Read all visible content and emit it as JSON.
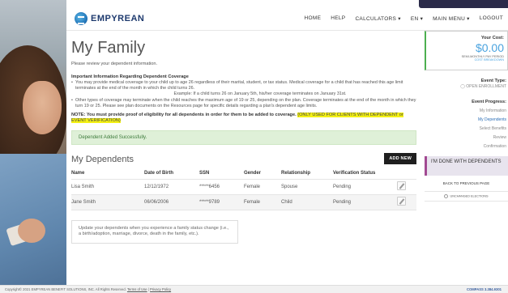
{
  "app": {
    "logo_text": "EMPYREAN"
  },
  "nav": {
    "home": "HOME",
    "help": "HELP",
    "calculators": "CALCULATORS ▾",
    "language": "EN ▾",
    "main_menu": "MAIN MENU ▾",
    "logout": "LOGOUT"
  },
  "page": {
    "title": "My Family",
    "intro": "Please review your dependent information.",
    "important_heading": "Important Information Regarding Dependent Coverage",
    "note_1": "You may provide medical coverage to your child up to age 26 regardless of their marital, student, or tax status. Medical coverage for a child that has reached this age limit terminates at the end of the month in which the child turns 26.",
    "example": "Example: If a child turns 26 on January 5th, his/her coverage terminates on January 31st.",
    "note_2": "Other types of coverage may terminate when the child reaches the maximum age of 19 or 25, depending on the plan. Coverage terminates at the end of the month in which they turn 19 or 25. Please see plan documents on the Resources page for specific details regarding a plan's dependent age limits.",
    "notice_text": "NOTE: You must provide proof of eligibility for all dependents in order for them to be added to coverage.",
    "notice_highlight": "(ONLY USED FOR CLIENTS WITH DEPENDENT or EVENT VERIFICATION)",
    "success_message": "Dependent Added Successfully."
  },
  "dependents": {
    "title": "My Dependents",
    "add_button": "ADD NEW",
    "columns": [
      "Name",
      "Date of Birth",
      "SSN",
      "Gender",
      "Relationship",
      "Verification Status"
    ],
    "rows": [
      {
        "name": "Lisa  Smith",
        "dob": "12/12/1972",
        "ssn": "*****6456",
        "gender": "Female",
        "relationship": "Spouse",
        "status": "Pending"
      },
      {
        "name": "Jane  Smith",
        "dob": "06/06/2006",
        "ssn": "*****9789",
        "gender": "Female",
        "relationship": "Child",
        "status": "Pending"
      }
    ],
    "update_note": "Update your dependents when you experience a family status change (i.e., a birth/adoption, marriage, divorce, death in the family, etc.)."
  },
  "sidebar": {
    "cost_label": "Your Cost:",
    "cost_value": "$0.00",
    "cost_period": "SEMI-MONTHLY PAY PERIOD",
    "cost_breakdown": "COST BREAKDOWN",
    "event_type_label": "Event Type:",
    "event_type_value": "OPEN ENROLLMENT",
    "progress_label": "Event Progress:",
    "steps": [
      "My Information",
      "My Dependents",
      "Select Benefits",
      "Review",
      "Confirmation"
    ],
    "done_button": "I'M DONE WITH DEPENDENTS",
    "back_link": "BACK TO PREVIOUS PAGE",
    "unchanged": "UNCHANGED ELECTIONS"
  },
  "footer": {
    "copyright": "Copyright© 2021 EMPYREAN BENEFIT SOLUTIONS, INC. All Rights Reserved.",
    "terms": "Terms of Use",
    "privacy": "Privacy Policy",
    "brand": "COMPASS",
    "phone": "3.384.9301"
  },
  "colors": {
    "accent_blue": "#4aa3df",
    "success_bg": "#dff0d8",
    "highlight": "#f3f014",
    "done_accent": "#a24a92"
  }
}
